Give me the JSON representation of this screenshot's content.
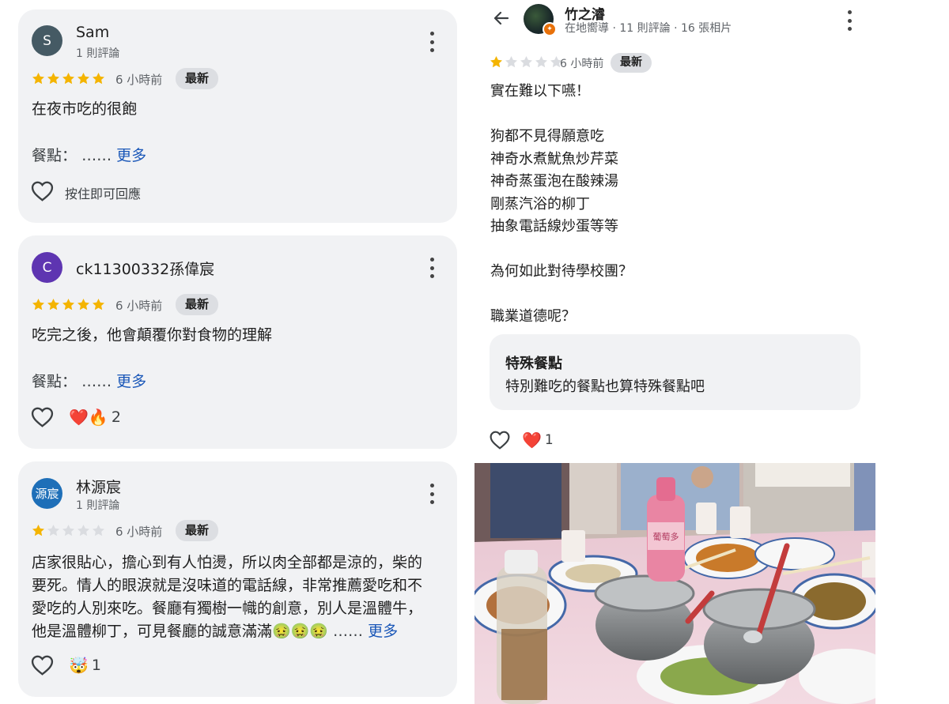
{
  "left_reviews": [
    {
      "avatar_letter": "S",
      "avatar_color": "#455a64",
      "name": "Sam",
      "sub": "1 則評論",
      "rating": 5,
      "time": "6 小時前",
      "badge": "最新",
      "text": "在夜市吃的很飽",
      "meal_label": "餐點：",
      "ellipsis": "……",
      "more": "更多",
      "reply": "按住即可回應"
    },
    {
      "avatar_letter": "C",
      "avatar_color": "#5e35b1",
      "name": "ck11300332孫偉宸",
      "rating": 5,
      "time": "6 小時前",
      "badge": "最新",
      "text": "吃完之後，他會顛覆你對食物的理解",
      "meal_label": "餐點：",
      "ellipsis": "……",
      "more": "更多",
      "reactions": "❤️🔥",
      "reaction_count": "2"
    },
    {
      "avatar_letter": "源宸",
      "avatar_color": "#1e6fb8",
      "name": "林源宸",
      "sub": "1 則評論",
      "rating": 1,
      "time": "6 小時前",
      "badge": "最新",
      "text_lines": [
        "店家很貼心，擔心到有人怕燙，所以肉全部都是涼的，柴的",
        "要死。情人的眼淚就是沒味道的電話線，非常推薦愛吃和不",
        "愛吃的人別來吃。餐廳有獨樹一幟的創意，別人是溫體牛，",
        "他是溫體柳丁，可見餐廳的誠意滿滿🤢🤢🤢"
      ],
      "ellipsis": "……",
      "more": "更多",
      "reactions": "🤯",
      "reaction_count": "1"
    }
  ],
  "right_review": {
    "back_icon": "arrow-left-icon",
    "name": "竹之濬",
    "sub": "在地嚮導 · 11 則評論 · 16 張相片",
    "rating": 1,
    "time": "6 小時前",
    "badge": "最新",
    "lines": [
      "實在難以下嚥！",
      "",
      "狗都不見得願意吃",
      "神奇水煮魷魚炒芹菜",
      "神奇蒸蛋泡在酸辣湯",
      "剛蒸汽浴的柳丁",
      "抽象電話線炒蛋等等",
      "",
      "為何如此對待學校團？",
      "",
      "職業道德呢？"
    ],
    "special_title": "特殊餐點",
    "special_text": "特別難吃的餐點也算特殊餐點吧",
    "reactions": "❤️",
    "reaction_count": "1",
    "bottle_label": "葡萄多"
  },
  "colors": {
    "star_gold": "#f4b400",
    "star_gray": "#dadce0",
    "link_blue": "#1a57b8",
    "card_bg": "#f1f2f4"
  }
}
